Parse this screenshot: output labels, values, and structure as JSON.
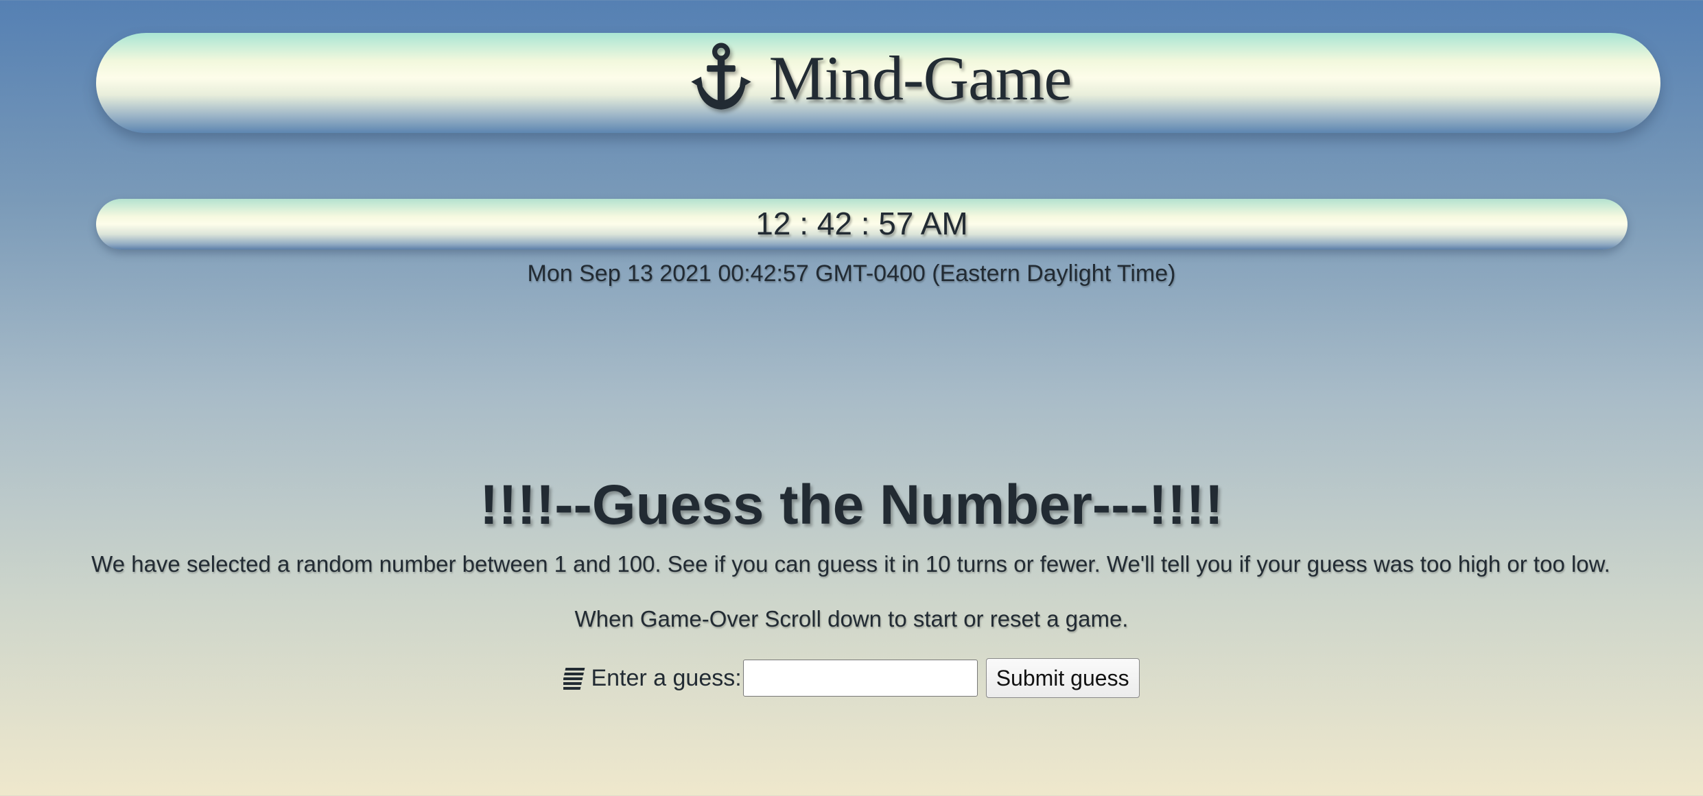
{
  "header": {
    "title": "Mind-Game",
    "icon": "anchor-icon"
  },
  "clock": {
    "time": "12 : 42 : 57 AM",
    "full_date": "Mon Sep 13 2021 00:42:57 GMT-0400 (Eastern Daylight Time)"
  },
  "game": {
    "heading": "!!!!--Guess the Number---!!!!",
    "instructions": "We have selected a random number between 1 and 100. See if you can guess it in 10 turns or fewer. We'll tell you if your guess was too high or too low.",
    "scroll_note": "When Game-Over Scroll down to start or reset a game.",
    "guess_label": "Enter a guess:",
    "guess_value": "",
    "guess_icon": "lines-icon",
    "submit_label": "Submit guess"
  },
  "colors": {
    "text": "#222b33",
    "background_top": "#5580b3",
    "background_bottom": "#efe8cc"
  }
}
